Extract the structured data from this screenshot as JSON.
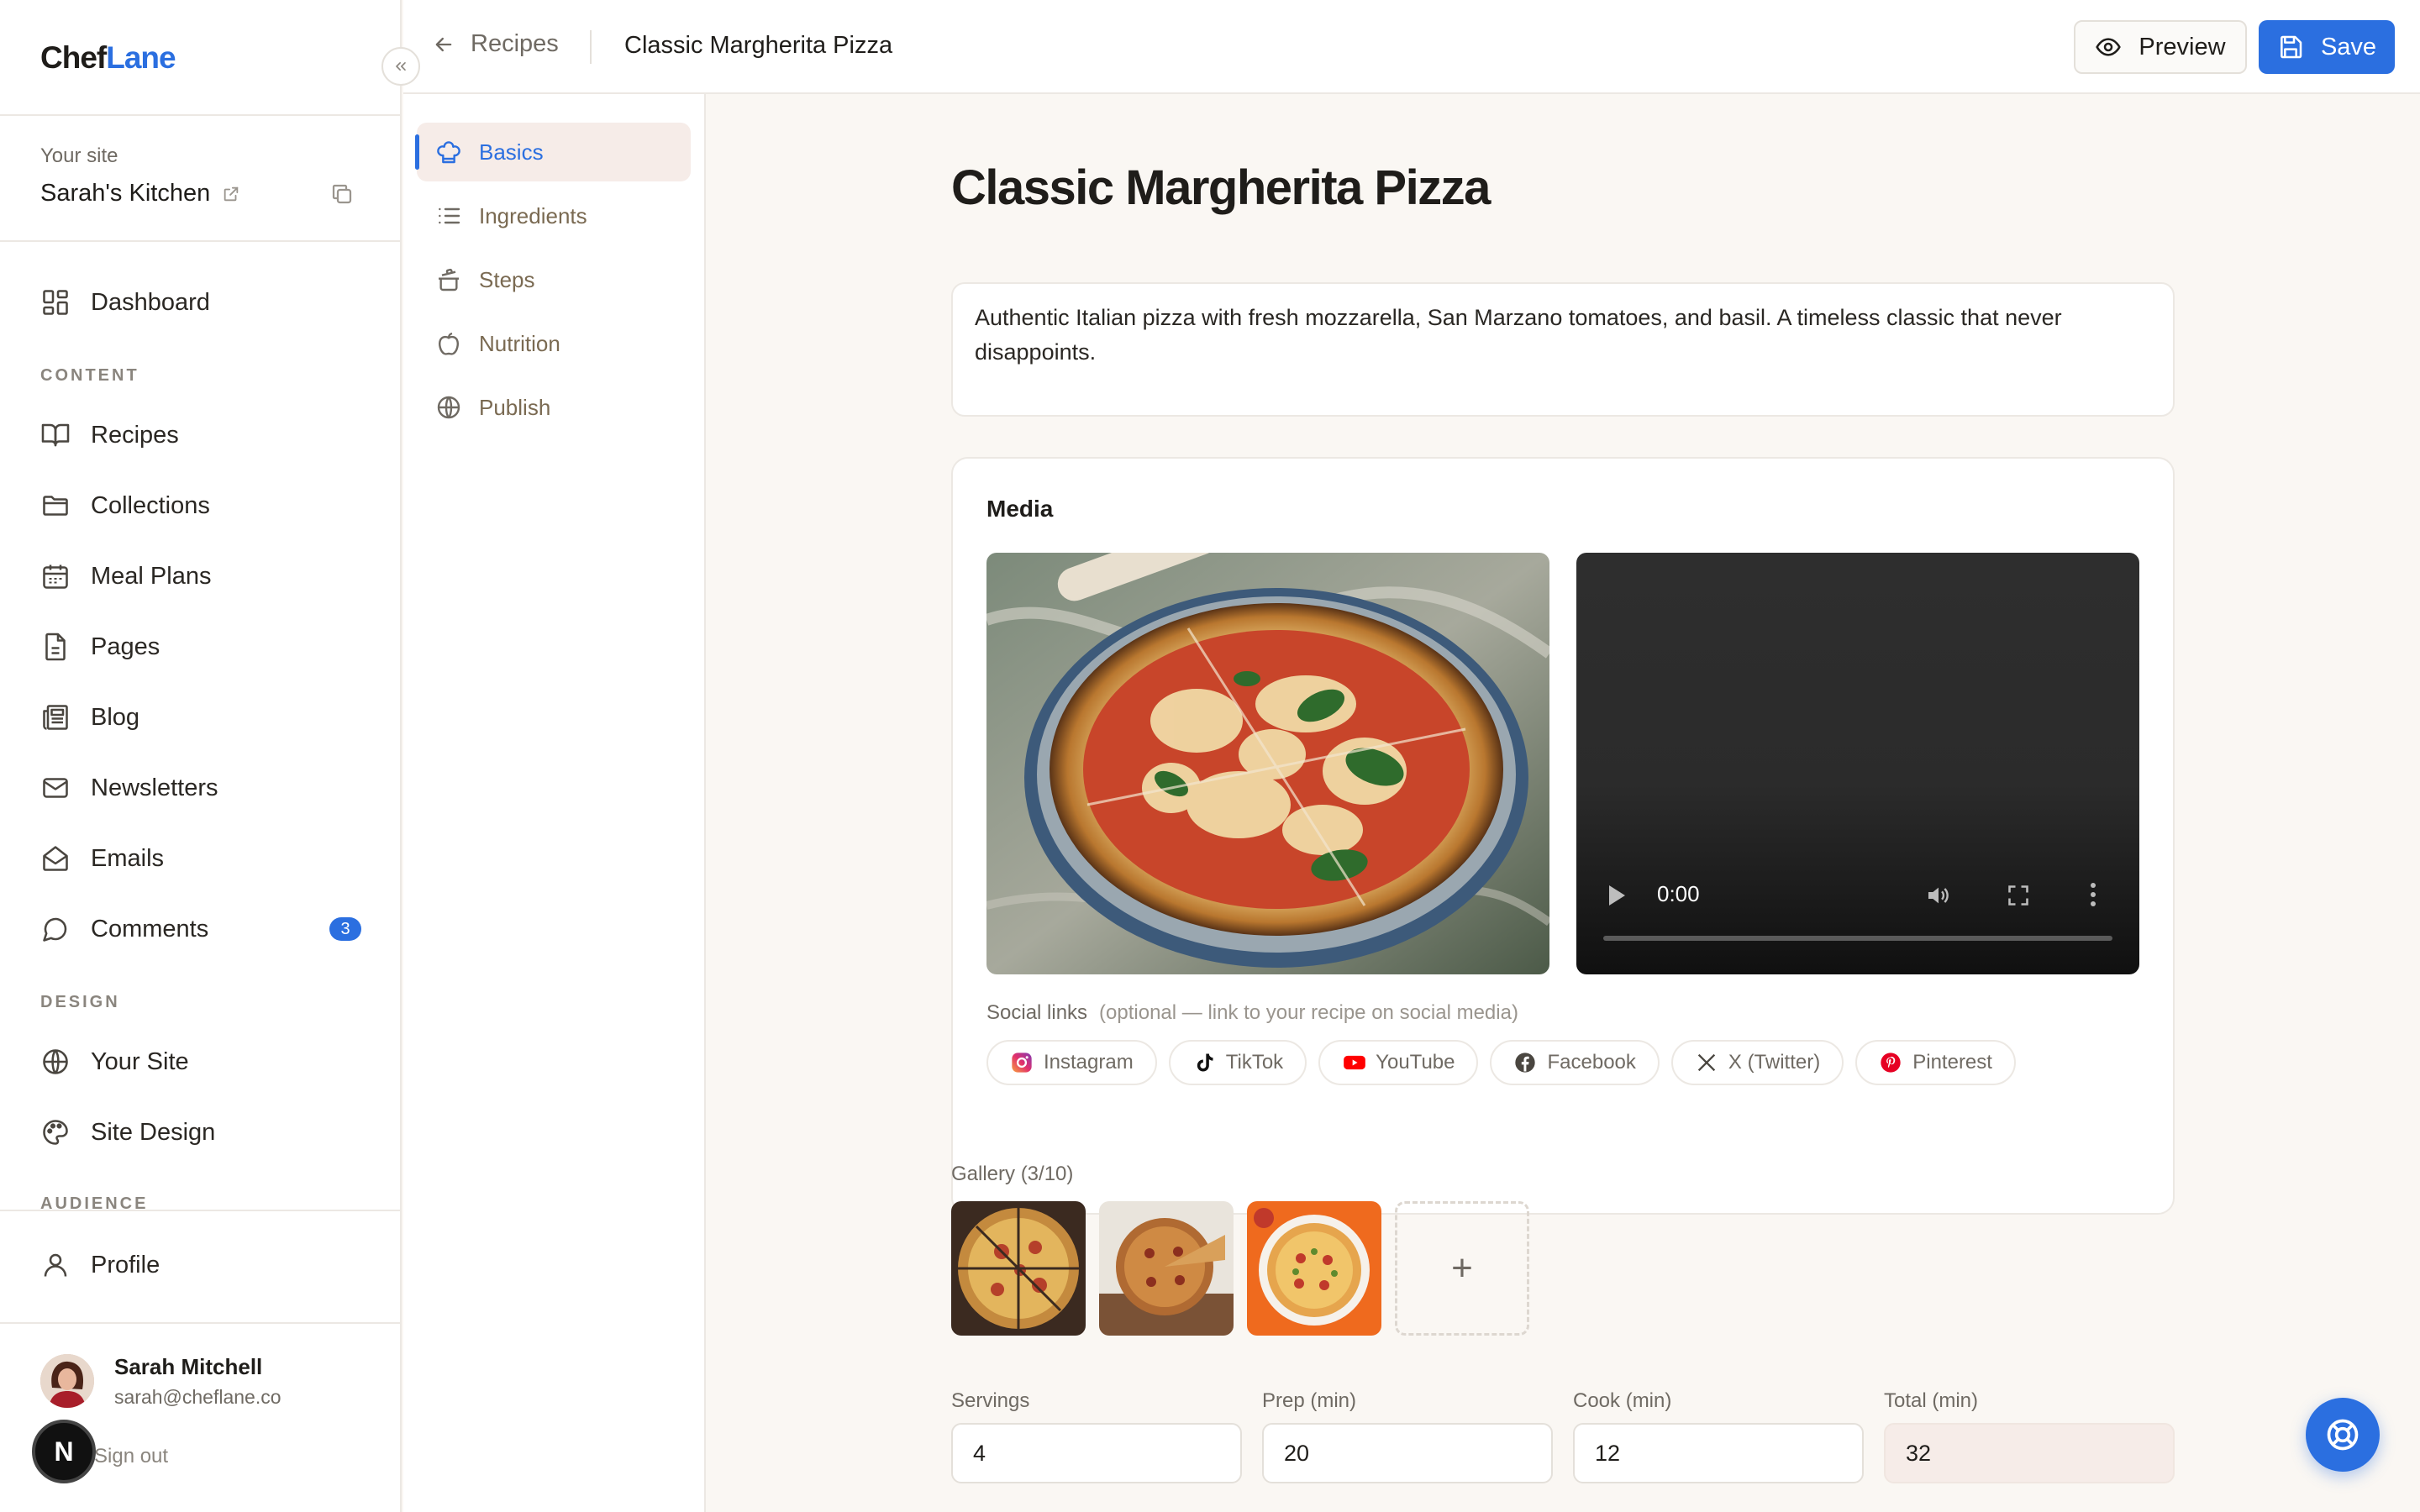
{
  "app": {
    "logo_part1": "Chef",
    "logo_part2": "Lane"
  },
  "site": {
    "label": "Your site",
    "name": "Sarah's Kitchen"
  },
  "sidebar": {
    "dashboard": "Dashboard",
    "section_content": "CONTENT",
    "content_items": [
      {
        "label": "Recipes",
        "icon": "book-icon"
      },
      {
        "label": "Collections",
        "icon": "folder-icon"
      },
      {
        "label": "Meal Plans",
        "icon": "calendar-icon"
      },
      {
        "label": "Pages",
        "icon": "file-icon"
      },
      {
        "label": "Blog",
        "icon": "newspaper-icon"
      },
      {
        "label": "Newsletters",
        "icon": "mail-icon"
      },
      {
        "label": "Emails",
        "icon": "mail-open-icon"
      },
      {
        "label": "Comments",
        "icon": "message-circle-icon"
      }
    ],
    "comments_badge": "3",
    "section_design": "DESIGN",
    "design_items": [
      {
        "label": "Your Site",
        "icon": "globe-icon"
      },
      {
        "label": "Site Design",
        "icon": "palette-icon"
      }
    ],
    "section_audience": "AUDIENCE",
    "profile": "Profile"
  },
  "user": {
    "name": "Sarah Mitchell",
    "email": "sarah@cheflane.co",
    "signout": "Sign out",
    "n_badge": "N"
  },
  "topbar": {
    "back_label": "Recipes",
    "title": "Classic Margherita Pizza",
    "preview": "Preview",
    "save": "Save"
  },
  "section_nav": [
    {
      "label": "Basics",
      "icon": "chef-hat-icon",
      "active": true
    },
    {
      "label": "Ingredients",
      "icon": "list-icon",
      "active": false
    },
    {
      "label": "Steps",
      "icon": "cooking-pot-icon",
      "active": false
    },
    {
      "label": "Nutrition",
      "icon": "apple-icon",
      "active": false
    },
    {
      "label": "Publish",
      "icon": "globe-icon",
      "active": false
    }
  ],
  "recipe": {
    "title": "Classic Margherita Pizza",
    "description": "Authentic Italian pizza with fresh mozzarella, San Marzano tomatoes, and basil. A timeless classic that never disappoints."
  },
  "media": {
    "title": "Media",
    "video_time": "0:00",
    "social_label": "Social links",
    "social_hint": "(optional — link to your recipe on social media)",
    "social": [
      {
        "label": "Instagram",
        "icon": "instagram-icon",
        "color": "#e1306c"
      },
      {
        "label": "TikTok",
        "icon": "tiktok-icon",
        "color": "#111111"
      },
      {
        "label": "YouTube",
        "icon": "youtube-icon",
        "color": "#ff0000"
      },
      {
        "label": "Facebook",
        "icon": "facebook-icon",
        "color": "#4a4640"
      },
      {
        "label": "X (Twitter)",
        "icon": "x-icon",
        "color": "#4a4640"
      },
      {
        "label": "Pinterest",
        "icon": "pinterest-icon",
        "color": "#e60023"
      }
    ]
  },
  "gallery": {
    "label": "Gallery (3/10)",
    "add": "+"
  },
  "fields": {
    "servings_label": "Servings",
    "servings": "4",
    "prep_label": "Prep (min)",
    "prep": "20",
    "cook_label": "Cook (min)",
    "cook": "12",
    "total_label": "Total (min)",
    "total": "32"
  },
  "colors": {
    "accent": "#2b6fe0",
    "background": "#faf7f3",
    "active_bg": "#f6ece8"
  }
}
